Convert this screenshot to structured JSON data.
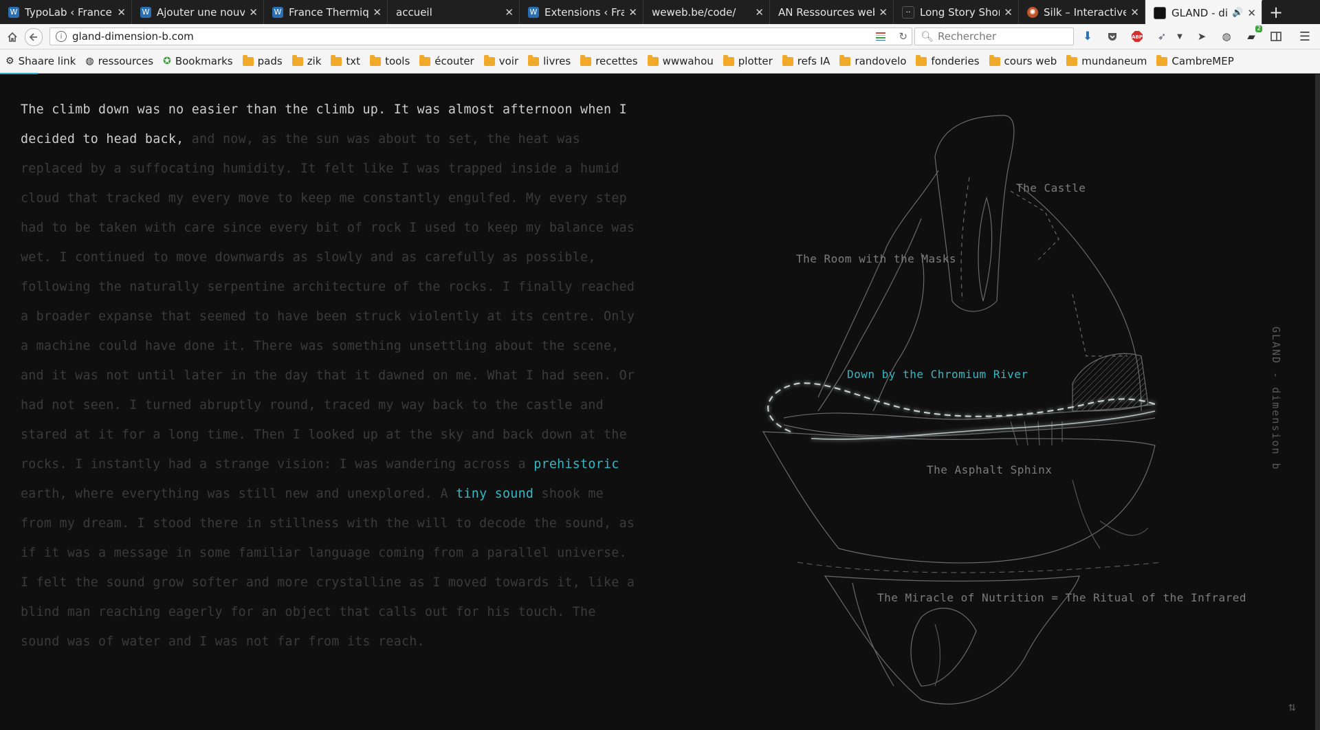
{
  "browser": {
    "tabs": [
      {
        "title": "TypoLab ‹ France Th",
        "icon": "wp-icon",
        "color": "#2b6fb3"
      },
      {
        "title": "Ajouter une nouvelle",
        "icon": "wp-icon",
        "color": "#2b6fb3"
      },
      {
        "title": "France Thermique ·",
        "icon": "wp-icon",
        "color": "#2b6fb3"
      },
      {
        "title": "accueil",
        "icon": "",
        "color": ""
      },
      {
        "title": "Extensions ‹ France",
        "icon": "wp-icon",
        "color": "#2b6fb3"
      },
      {
        "title": "weweb.be/code/",
        "icon": "",
        "color": ""
      },
      {
        "title": "AN Ressources web",
        "icon": "",
        "color": ""
      },
      {
        "title": "Long Story Short D",
        "icon": "dots-icon",
        "color": "#222"
      },
      {
        "title": "Silk – Interactive Ge",
        "icon": "silk-icon",
        "color": "#c0552a"
      },
      {
        "title": "GLAND - dimension",
        "icon": "gland-icon",
        "color": "#111"
      }
    ],
    "url": "gland-dimension-b.com",
    "search_placeholder": "Rechercher",
    "badge_count": "2",
    "bookmarks": [
      {
        "label": "Shaare link",
        "type": "link"
      },
      {
        "label": "ressources",
        "type": "link"
      },
      {
        "label": "Bookmarks",
        "type": "star"
      },
      {
        "label": "pads",
        "type": "folder"
      },
      {
        "label": "zik",
        "type": "folder"
      },
      {
        "label": "txt",
        "type": "folder"
      },
      {
        "label": "tools",
        "type": "folder"
      },
      {
        "label": "écouter",
        "type": "folder"
      },
      {
        "label": "voir",
        "type": "folder"
      },
      {
        "label": "livres",
        "type": "folder"
      },
      {
        "label": "recettes",
        "type": "folder"
      },
      {
        "label": "wwwahou",
        "type": "folder"
      },
      {
        "label": "plotter",
        "type": "folder"
      },
      {
        "label": "refs IA",
        "type": "folder"
      },
      {
        "label": "randovelo",
        "type": "folder"
      },
      {
        "label": "fonderies",
        "type": "folder"
      },
      {
        "label": "cours web",
        "type": "folder"
      },
      {
        "label": "mundaneum",
        "type": "folder"
      },
      {
        "label": "CambreMEP",
        "type": "folder"
      }
    ]
  },
  "page": {
    "story": {
      "intro": "The climb down was no easier than the climb up. ",
      "highlight": "It was almost afternoon when I decided to head back,",
      "part1": " and now, as the sun was about to set, the heat was replaced by a suffocating humidity. It felt like I was trapped inside a humid cloud that tracked my every move to keep me constantly engulfed. My every step had to be taken with care since every bit of rock I used to keep my balance was wet. I continued to move downwards as slowly and as carefully as possible, following the naturally serpentine architecture of the rocks. I finally reached a broader expanse that seemed to have been struck violently at its centre. Only a machine could have done it. There was something unsettling about the scene, and it was not until later in the day that it dawned on me. What I had seen. Or had not seen. I turned abruptly round, traced my way back to the castle and stared at it for a long time. Then I looked up at the sky and back down at the rocks. I instantly had a strange vision: I was wandering across a ",
      "link1": "prehistoric",
      "part2": " earth, where everything was still new and unexplored. A ",
      "link2": "tiny sound",
      "part3": " shook me from my dream. I stood there in stillness with the will to decode the sound, as if it was a message in some familiar language coming from a parallel universe. I felt the sound grow softer and more crystalline as I moved towards it, like a blind man reaching eagerly for an object that calls out for his touch. The sound was of water and I was not far from its reach."
    },
    "map_labels": {
      "castle": "The Castle",
      "masks": "The Room with the Masks",
      "river": "Down by the Chromium River",
      "sphinx": "The Asphalt Sphinx",
      "nutrition": "The Miracle of Nutrition = The Ritual of the Infrared"
    },
    "side_title": "GLAND - dimension b",
    "corner_mark": "⇅"
  },
  "colors": {
    "accent": "#36b8c4",
    "page_bg": "#0f0f0f",
    "dim_text": "#3b3b3b",
    "bright_text": "#cfcfcf"
  }
}
